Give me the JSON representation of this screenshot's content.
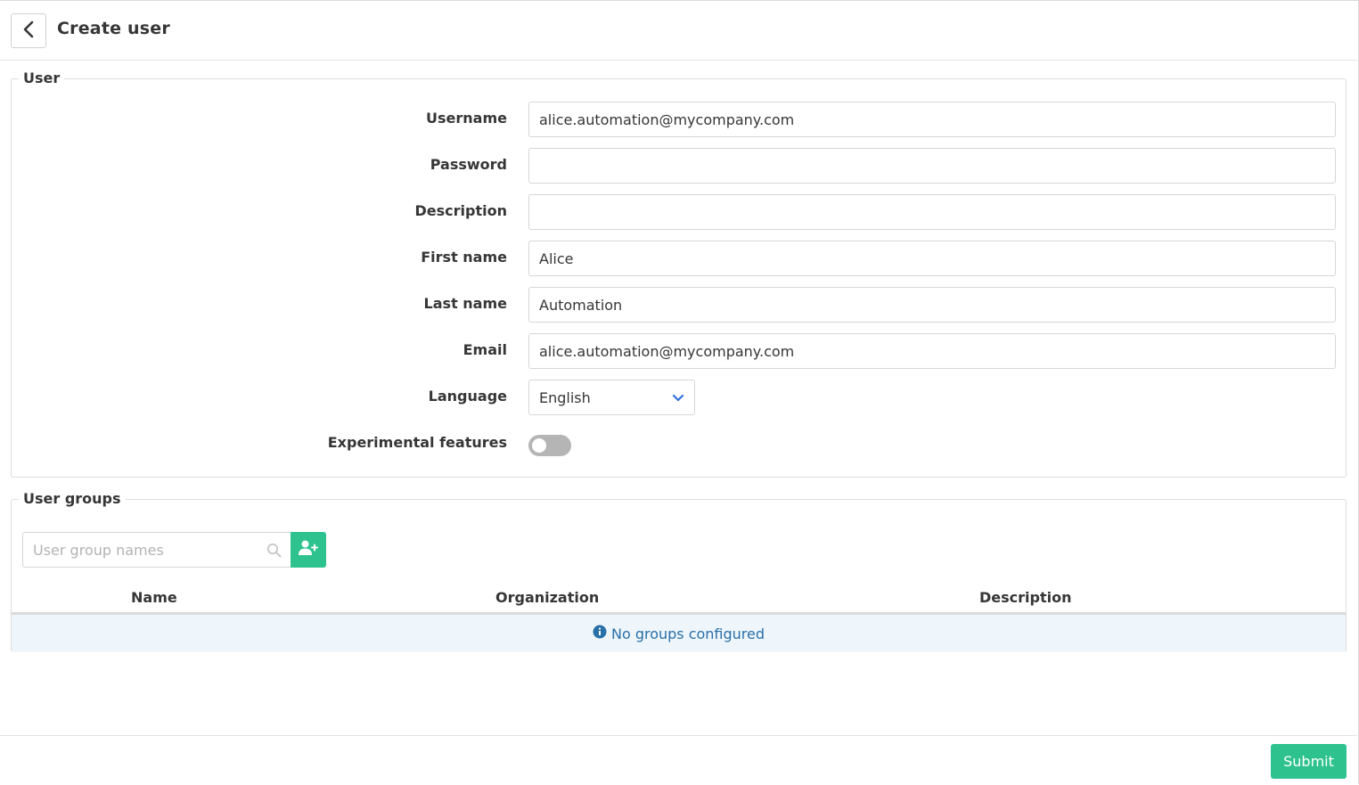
{
  "header": {
    "title": "Create user",
    "back_icon": "chevron-left-icon"
  },
  "user_section": {
    "legend": "User",
    "fields": {
      "username": {
        "label": "Username",
        "value": "alice.automation@mycompany.com"
      },
      "password": {
        "label": "Password",
        "value": ""
      },
      "description": {
        "label": "Description",
        "value": ""
      },
      "first_name": {
        "label": "First name",
        "value": "Alice"
      },
      "last_name": {
        "label": "Last name",
        "value": "Automation"
      },
      "email": {
        "label": "Email",
        "value": "alice.automation@mycompany.com"
      },
      "language": {
        "label": "Language",
        "value": "English"
      },
      "experimental": {
        "label": "Experimental features",
        "enabled": false
      }
    }
  },
  "groups_section": {
    "legend": "User groups",
    "search_placeholder": "User group names",
    "columns": [
      "Name",
      "Organization",
      "Description"
    ],
    "empty_message": "No groups configured"
  },
  "footer": {
    "submit_label": "Submit"
  },
  "colors": {
    "accent": "#2ec28f",
    "info_text": "#296fa8",
    "info_bg": "#eef6fb",
    "chevron": "#3273dc"
  }
}
